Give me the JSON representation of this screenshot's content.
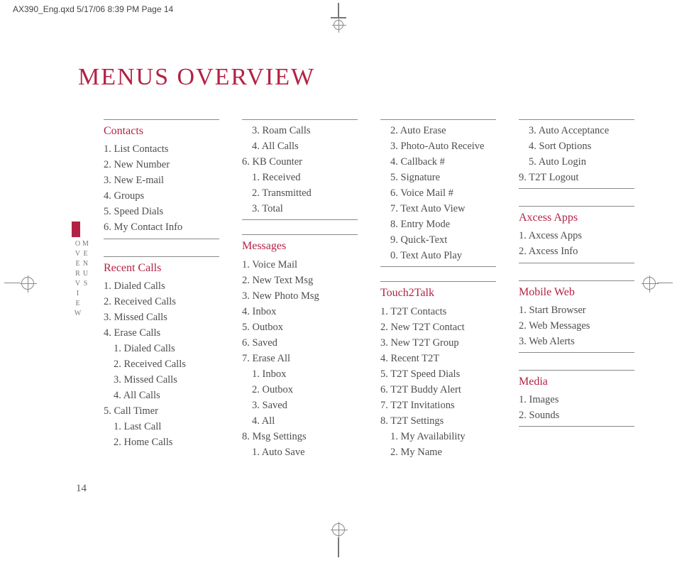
{
  "slug": "AX390_Eng.qxd  5/17/06  8:39 PM  Page 14",
  "title": "MENUS OVERVIEW",
  "side_tab": "MENUS OVERVIEW",
  "page_number": "14",
  "col1": {
    "contacts": {
      "title": "Contacts",
      "items": [
        "1. List Contacts",
        "2. New Number",
        "3. New E-mail",
        "4. Groups",
        "5. Speed Dials",
        "6. My Contact Info"
      ]
    },
    "recent_calls": {
      "title": "Recent Calls",
      "items": [
        "1. Dialed Calls",
        "2. Received Calls",
        "3. Missed Calls",
        "4. Erase Calls"
      ],
      "sub_erase": [
        "1. Dialed Calls",
        "2. Received Calls",
        "3. Missed Calls",
        "4. All Calls"
      ],
      "item5": "5. Call Timer",
      "sub_timer": [
        "1. Last Call",
        "2. Home Calls"
      ]
    }
  },
  "col2": {
    "cont_timer": [
      "3. Roam Calls",
      "4. All Calls"
    ],
    "kb_counter": "6. KB Counter",
    "kb_sub": [
      "1. Received",
      "2. Transmitted",
      "3. Total"
    ],
    "messages": {
      "title": "Messages",
      "items": [
        "1. Voice Mail",
        "2. New Text Msg",
        "3. New Photo Msg",
        "4. Inbox",
        "5. Outbox",
        "6. Saved",
        "7. Erase All"
      ],
      "erase_sub": [
        "1. Inbox",
        "2. Outbox",
        "3. Saved",
        "4. All"
      ],
      "item8": "8. Msg Settings",
      "settings_sub1": "1. Auto Save"
    }
  },
  "col3": {
    "settings_cont": [
      "2. Auto Erase",
      "3. Photo-Auto Receive",
      "4. Callback #",
      "5. Signature",
      "6. Voice Mail #",
      "7. Text Auto View",
      "8. Entry Mode",
      "9. Quick-Text",
      "0. Text Auto Play"
    ],
    "touch2talk": {
      "title": "Touch2Talk",
      "items": [
        "1. T2T Contacts",
        "2. New T2T Contact",
        "3. New T2T Group",
        "4. Recent T2T",
        "5. T2T Speed Dials",
        "6. T2T Buddy Alert",
        "7.  T2T Invitations",
        "8. T2T Settings"
      ],
      "sub": [
        "1. My Availability",
        "2. My Name"
      ]
    }
  },
  "col4": {
    "t2t_cont": [
      "3. Auto Acceptance",
      "4. Sort Options",
      "5. Auto Login"
    ],
    "t2t_logout": "9. T2T Logout",
    "axcess": {
      "title": "Axcess Apps",
      "items": [
        "1. Axcess Apps",
        "2. Axcess Info"
      ]
    },
    "mobileweb": {
      "title": " Mobile Web",
      "items": [
        "1. Start Browser",
        "2. Web Messages",
        "3. Web Alerts"
      ]
    },
    "media": {
      "title": "Media",
      "items": [
        "1. Images",
        "2. Sounds"
      ]
    }
  }
}
